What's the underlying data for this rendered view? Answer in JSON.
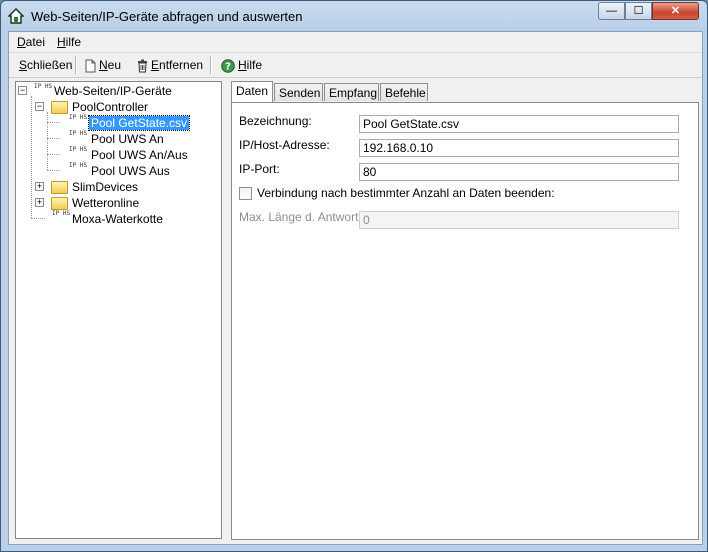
{
  "window": {
    "title": "Web-Seiten/IP-Geräte abfragen und auswerten",
    "controls": {
      "minimize": "—",
      "maximize": "☐",
      "close": "✕"
    }
  },
  "menubar": {
    "file_prefix": "D",
    "file_rest": "atei",
    "help_prefix": "H",
    "help_rest": "ilfe"
  },
  "toolbar": {
    "close_label_underlined": "S",
    "close_label_rest": "chließen",
    "new_label_underlined": "N",
    "new_label_rest": "eu",
    "remove_label_underlined": "E",
    "remove_label_rest": "ntfernen",
    "help_label_underlined": "H",
    "help_label_rest": "ilfe"
  },
  "tree": {
    "root": "Web-Seiten/IP-Geräte",
    "pool_controller": "PoolController",
    "pool_items": [
      "Pool GetState.csv",
      "Pool UWS An",
      "Pool UWS An/Aus",
      "Pool UWS Aus"
    ],
    "slim_devices": "SlimDevices",
    "wetteronline": "Wetteronline",
    "moxa": "Moxa-Waterkotte",
    "ip_icon_text": "IP HS"
  },
  "tabs": [
    "Daten",
    "Senden",
    "Empfang",
    "Befehle"
  ],
  "form": {
    "name_label": "Bezeichnung:",
    "name_value": "Pool GetState.csv",
    "host_label": "IP/Host-Adresse:",
    "host_value": "192.168.0.10",
    "port_label": "IP-Port:",
    "port_value": "80",
    "checkbox_label": "Verbindung nach bestimmter Anzahl an Daten beenden:",
    "checkbox_checked": false,
    "max_len_label": "Max. Länge d. Antwort:",
    "max_len_value": "0"
  }
}
